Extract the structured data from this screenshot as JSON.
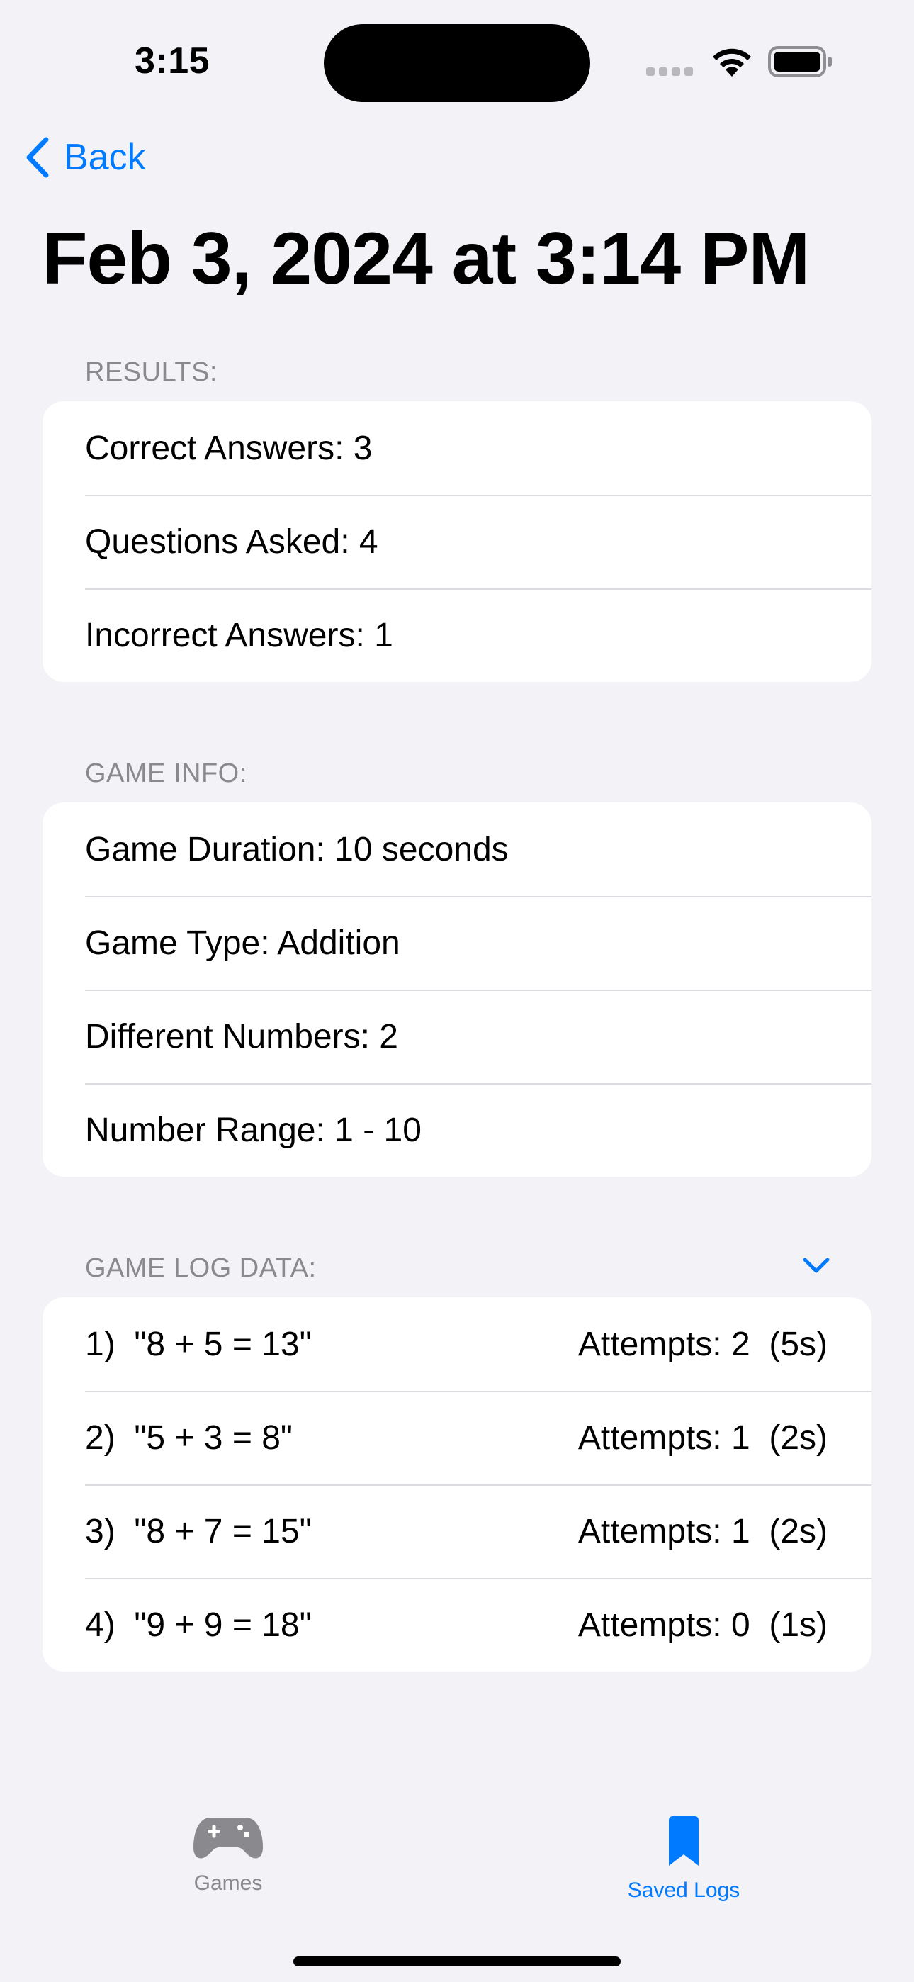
{
  "status_bar": {
    "time": "3:15"
  },
  "nav": {
    "back_label": "Back",
    "title": "Feb 3, 2024 at 3:14 PM"
  },
  "results": {
    "header": "RESULTS:",
    "rows": [
      "Correct Answers: 3",
      "Questions Asked: 4",
      "Incorrect Answers: 1"
    ]
  },
  "game_info": {
    "header": "GAME INFO:",
    "rows": [
      "Game Duration: 10 seconds",
      "Game Type: Addition",
      "Different Numbers: 2",
      "Number Range: 1 - 10"
    ]
  },
  "game_log": {
    "header": "GAME LOG DATA:",
    "expand_icon": "chevron-down-icon",
    "rows": [
      {
        "question": "1)  \"8 + 5 = 13\"",
        "attempts": "Attempts: 2  (5s)"
      },
      {
        "question": "2)  \"5 + 3 = 8\"",
        "attempts": "Attempts: 1  (2s)"
      },
      {
        "question": "3)  \"8 + 7 = 15\"",
        "attempts": "Attempts: 1  (2s)"
      },
      {
        "question": "4)  \"9 + 9 = 18\"",
        "attempts": "Attempts: 0  (1s)"
      }
    ]
  },
  "tab_bar": {
    "tabs": [
      {
        "label": "Games",
        "icon": "gamecontroller-icon",
        "selected": false
      },
      {
        "label": "Saved Logs",
        "icon": "bookmark-icon",
        "selected": true
      }
    ]
  },
  "colors": {
    "accent": "#007aff",
    "background": "#f2f2f7",
    "secondary_text": "#8a8a8e"
  }
}
